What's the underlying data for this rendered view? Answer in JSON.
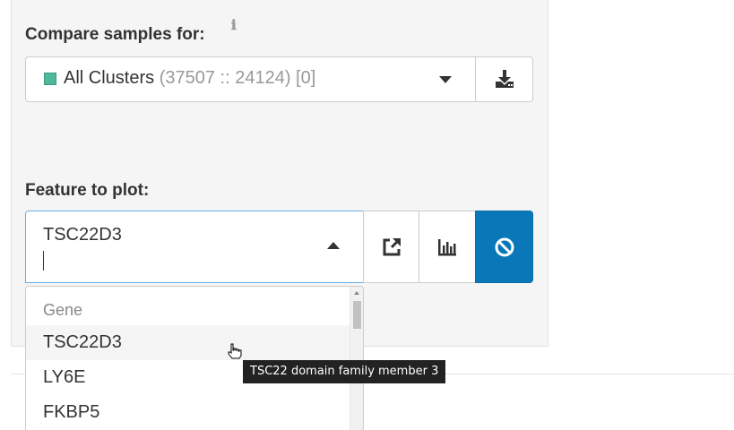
{
  "compare": {
    "label": "Compare samples for:",
    "info_icon": "info-icon",
    "selected": {
      "name": "All Clusters",
      "counts": "(37507 :: 24124)",
      "extra": "[0]",
      "color": "#4db89a"
    },
    "download_icon": "download-icon"
  },
  "feature": {
    "label": "Feature to plot:",
    "value": "TSC22D3",
    "buttons": [
      {
        "icon": "external-link-icon"
      },
      {
        "icon": "bar-chart-icon"
      },
      {
        "icon": "clear-icon",
        "color": "#0a78b8"
      }
    ],
    "dropdown": {
      "group": "Gene",
      "options": [
        "TSC22D3",
        "LY6E",
        "FKBP5"
      ],
      "hovered": "TSC22D3"
    }
  },
  "tooltip": {
    "text": "TSC22 domain family member 3"
  }
}
